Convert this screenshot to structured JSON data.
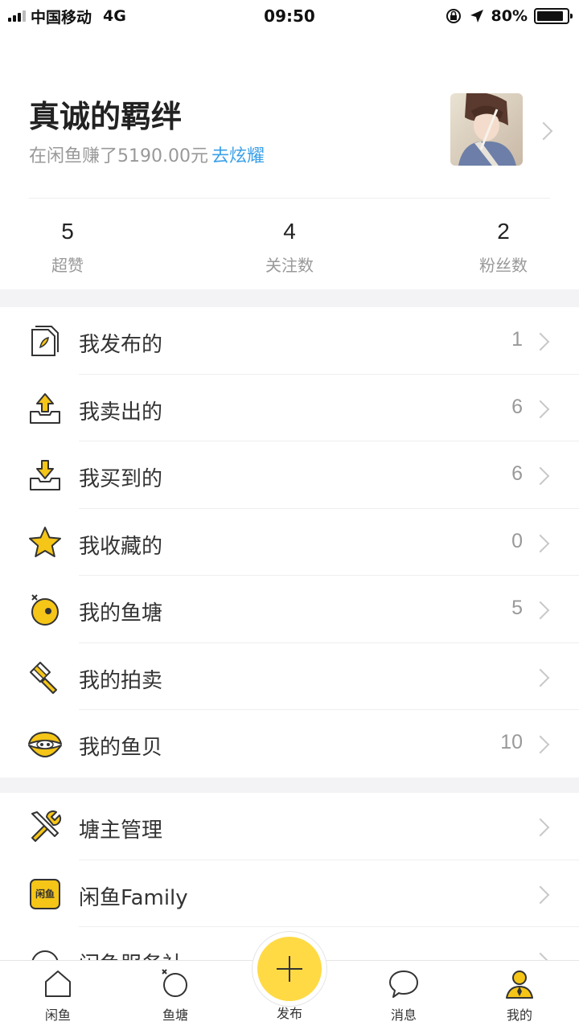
{
  "status_bar": {
    "carrier": "中国移动",
    "network": "4G",
    "time": "09:50",
    "battery": "80%",
    "battery_level": 0.8
  },
  "profile": {
    "name": "真诚的羁绊",
    "earned_text": "在闲鱼赚了5190.00元",
    "show_off_link": "去炫耀",
    "stats": [
      {
        "value": "5",
        "label": "超赞"
      },
      {
        "value": "4",
        "label": "关注数"
      },
      {
        "value": "2",
        "label": "粉丝数"
      }
    ]
  },
  "menu_group1": [
    {
      "icon": "document-icon",
      "label": "我发布的",
      "count": "1"
    },
    {
      "icon": "outbox-icon",
      "label": "我卖出的",
      "count": "6"
    },
    {
      "icon": "inbox-icon",
      "label": "我买到的",
      "count": "6"
    },
    {
      "icon": "star-icon",
      "label": "我收藏的",
      "count": "0"
    },
    {
      "icon": "fishpond-icon",
      "label": "我的鱼塘",
      "count": "5"
    },
    {
      "icon": "auction-hammer-icon",
      "label": "我的拍卖",
      "count": ""
    },
    {
      "icon": "shell-icon",
      "label": "我的鱼贝",
      "count": "10"
    }
  ],
  "menu_group2": [
    {
      "icon": "tools-icon",
      "label": "塘主管理",
      "count": ""
    },
    {
      "icon": "xianyu-badge-icon",
      "label": "闲鱼Family",
      "count": ""
    },
    {
      "icon": "headset-icon",
      "label": "闲鱼服务社",
      "count": ""
    }
  ],
  "badge_text": "闲鱼",
  "tabbar": [
    {
      "label": "闲鱼",
      "icon": "home-icon"
    },
    {
      "label": "鱼塘",
      "icon": "pond-icon"
    },
    {
      "label": "发布",
      "icon": "plus-icon"
    },
    {
      "label": "消息",
      "icon": "chat-bubble-icon"
    },
    {
      "label": "我的",
      "icon": "user-icon"
    }
  ],
  "colors": {
    "accent_yellow": "#ffda44",
    "link_blue": "#3aa0e8",
    "background": "#f3f3f5"
  }
}
